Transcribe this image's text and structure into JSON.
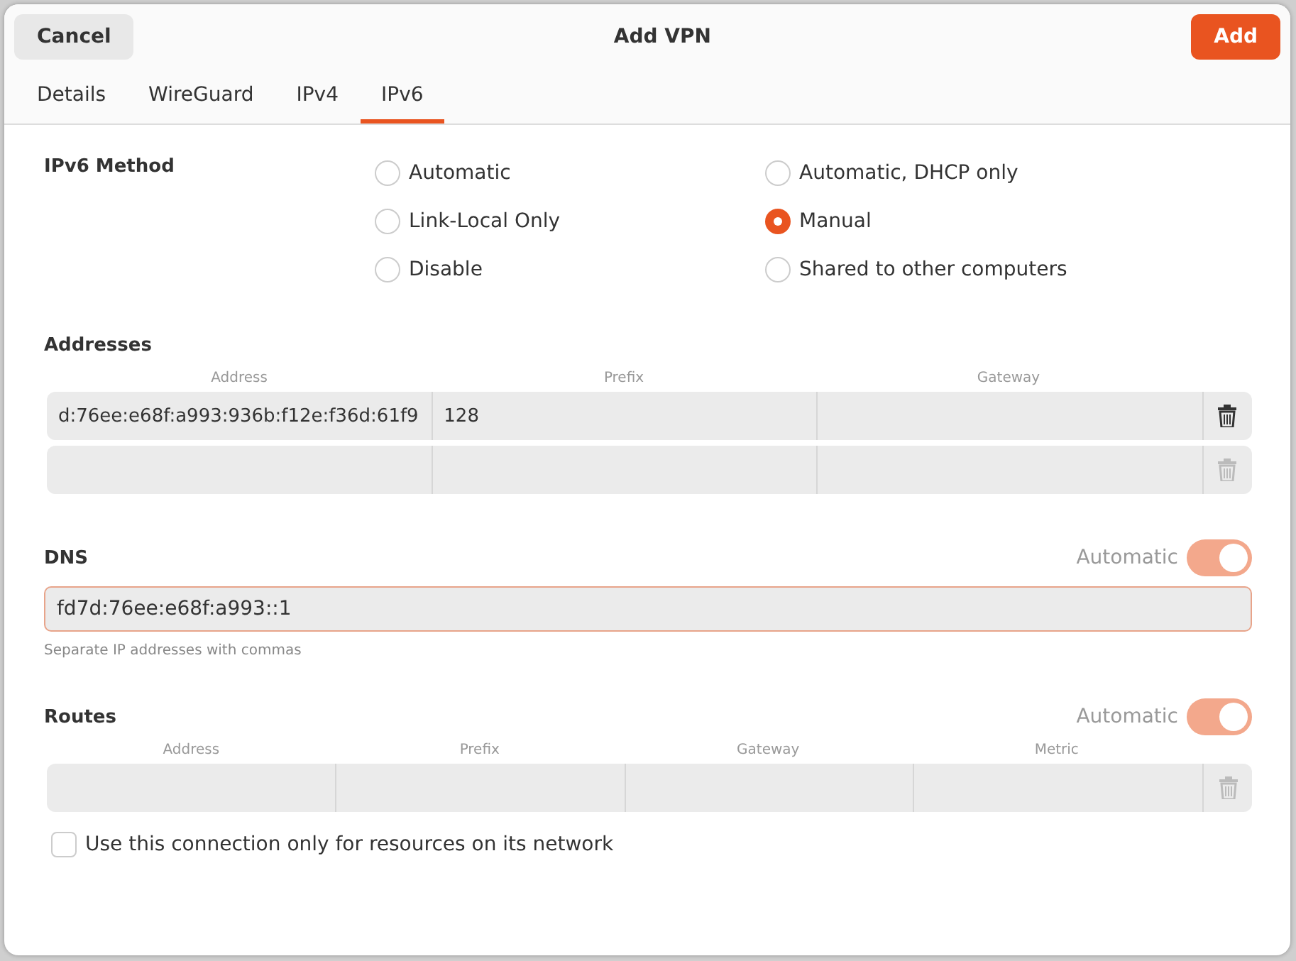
{
  "dialog": {
    "title": "Add VPN",
    "cancel": "Cancel",
    "confirm": "Add"
  },
  "tabs": [
    {
      "label": "Details",
      "selected": false
    },
    {
      "label": "WireGuard",
      "selected": false
    },
    {
      "label": "IPv4",
      "selected": false
    },
    {
      "label": "IPv6",
      "selected": true
    }
  ],
  "method": {
    "label": "IPv6 Method",
    "options": [
      {
        "label": "Automatic",
        "selected": false
      },
      {
        "label": "Automatic, DHCP only",
        "selected": false
      },
      {
        "label": "Link-Local Only",
        "selected": false
      },
      {
        "label": "Manual",
        "selected": true
      },
      {
        "label": "Disable",
        "selected": false
      },
      {
        "label": "Shared to other computers",
        "selected": false
      }
    ]
  },
  "addresses": {
    "label": "Addresses",
    "columns": [
      "Address",
      "Prefix",
      "Gateway"
    ],
    "rows": [
      {
        "cells": [
          "d:76ee:e68f:a993:936b:f12e:f36d:61f9",
          "128",
          ""
        ],
        "disabled": false
      },
      {
        "cells": [
          "",
          "",
          ""
        ],
        "disabled": true
      }
    ]
  },
  "dns": {
    "label": "DNS",
    "automatic_label": "Automatic",
    "automatic": true,
    "value": "fd7d:76ee:e68f:a993::1",
    "hint": "Separate IP addresses with commas"
  },
  "routes": {
    "label": "Routes",
    "automatic_label": "Automatic",
    "automatic": true,
    "columns": [
      "Address",
      "Prefix",
      "Gateway",
      "Metric"
    ],
    "rows": [
      {
        "cells": [
          "",
          "",
          "",
          ""
        ],
        "disabled": true
      }
    ]
  },
  "only_local": {
    "label": "Use this connection only for resources on its network",
    "checked": false
  }
}
